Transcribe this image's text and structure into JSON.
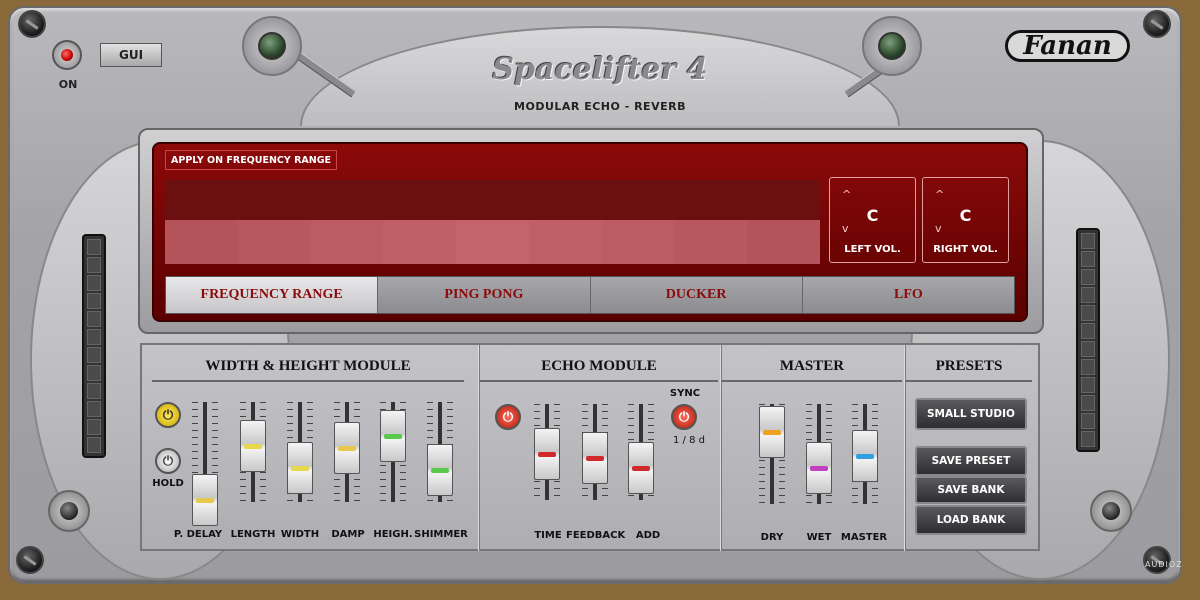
{
  "header": {
    "power_label": "ON",
    "gui_label": "GUI",
    "title": "Spacelifter 4",
    "subtitle": "MODULAR ECHO - REVERB",
    "brand": "Fanan"
  },
  "display": {
    "range_label": "APPLY ON FREQUENCY RANGE",
    "left_vol": {
      "up": "^",
      "down": "v",
      "value": "C",
      "label": "LEFT VOL."
    },
    "right_vol": {
      "up": "^",
      "down": "v",
      "value": "C",
      "label": "RIGHT VOL."
    },
    "band_colors": [
      "#b4545a",
      "#b8585e",
      "#bc5c62",
      "#c06066",
      "#c4646a",
      "#c06066",
      "#bc5c62",
      "#b8585e",
      "#b4545a"
    ]
  },
  "tabs": [
    {
      "label": "FREQUENCY RANGE",
      "active": true
    },
    {
      "label": "PING PONG",
      "active": false
    },
    {
      "label": "DUCKER",
      "active": false
    },
    {
      "label": "LFO",
      "active": false
    }
  ],
  "width_height": {
    "title": "WIDTH & HEIGHT MODULE",
    "hold_label": "HOLD",
    "faders": [
      {
        "label": "P. DELAY",
        "color": "#e6c84a"
      },
      {
        "label": "LENGTH",
        "color": "#e6d84a"
      },
      {
        "label": "WIDTH",
        "color": "#e6d84a"
      },
      {
        "label": "DAMP",
        "color": "#e6c84a"
      },
      {
        "label": "HEIGH.",
        "color": "#5ac84a"
      },
      {
        "label": "SHIMMER",
        "color": "#5ac84a"
      }
    ]
  },
  "echo": {
    "title": "ECHO MODULE",
    "sync_label": "SYNC",
    "sync_value": "1 / 8 d",
    "faders": [
      {
        "label": "TIME",
        "color": "#d02a2a"
      },
      {
        "label": "FEEDBACK",
        "color": "#d02a2a"
      },
      {
        "label": "ADD",
        "color": "#d02a2a"
      }
    ]
  },
  "master": {
    "title": "MASTER",
    "faders": [
      {
        "label": "DRY",
        "color": "#f0a020"
      },
      {
        "label": "WET",
        "color": "#c040c0"
      },
      {
        "label": "MASTER",
        "color": "#30a0e0"
      }
    ]
  },
  "presets": {
    "title": "PRESETS",
    "current": "SMALL STUDIO",
    "save_preset": "SAVE PRESET",
    "save_bank": "SAVE BANK",
    "load_bank": "LOAD BANK"
  },
  "watermark": "AUDIOZ"
}
